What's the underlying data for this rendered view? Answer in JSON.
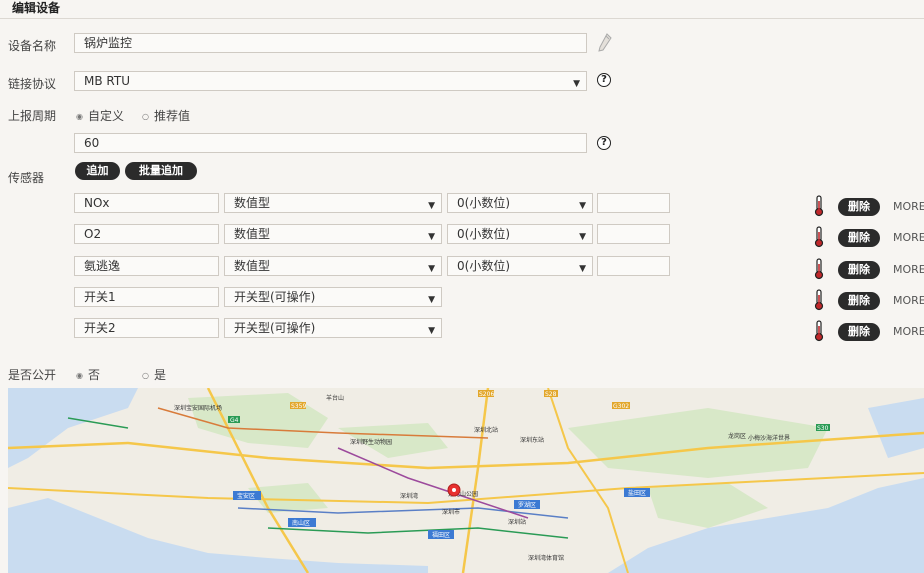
{
  "header": {
    "title": "编辑设备"
  },
  "device_name": {
    "label": "设备名称",
    "value": "锅炉监控",
    "edit_icon": "pencil-icon"
  },
  "protocol": {
    "label": "链接协议",
    "value": "MB RTU",
    "help_icon": "question-circle-icon",
    "help_glyph": "?"
  },
  "report_cycle": {
    "label": "上报周期",
    "options": [
      {
        "label": "自定义",
        "selected": true
      },
      {
        "label": "推荐值",
        "selected": false
      }
    ],
    "value": "60",
    "help_glyph": "?"
  },
  "sensors": {
    "label": "传感器",
    "add_label": "追加",
    "batch_add_label": "批量追加",
    "delete_label": "删除",
    "more_label": "MORE",
    "rows": [
      {
        "name": "NOx",
        "type": "数值型",
        "decimal": "0(小数位)",
        "unit": ""
      },
      {
        "name": "O2",
        "type": "数值型",
        "decimal": "0(小数位)",
        "unit": ""
      },
      {
        "name": "氨逃逸",
        "type": "数值型",
        "decimal": "0(小数位)",
        "unit": ""
      },
      {
        "name": "开关1",
        "type": "开关型(可操作)"
      },
      {
        "name": "开关2",
        "type": "开关型(可操作)"
      }
    ]
  },
  "public": {
    "label": "是否公开",
    "options": [
      {
        "label": "否",
        "selected": true
      },
      {
        "label": "是",
        "selected": false
      }
    ]
  },
  "map": {
    "labels": [
      "深圳宝安国际机场",
      "羊台山",
      "深圳野生动物园",
      "深圳北站",
      "深圳东站",
      "深圳湾",
      "莲花山公园",
      "深圳市",
      "罗湖区",
      "福田区",
      "南山区",
      "宝安区",
      "龙岗区",
      "盐田区",
      "深圳站",
      "小梅沙海洋世界",
      "深圳湾体育馆"
    ],
    "road_badges": [
      "G4",
      "S359",
      "S206",
      "S28",
      "G302",
      "S30"
    ],
    "colors": {
      "water": "#c9dcf0",
      "land": "#f0ede5",
      "green": "#d8e8c8",
      "road": "#f5c74a",
      "pin": "#e8312f"
    }
  }
}
